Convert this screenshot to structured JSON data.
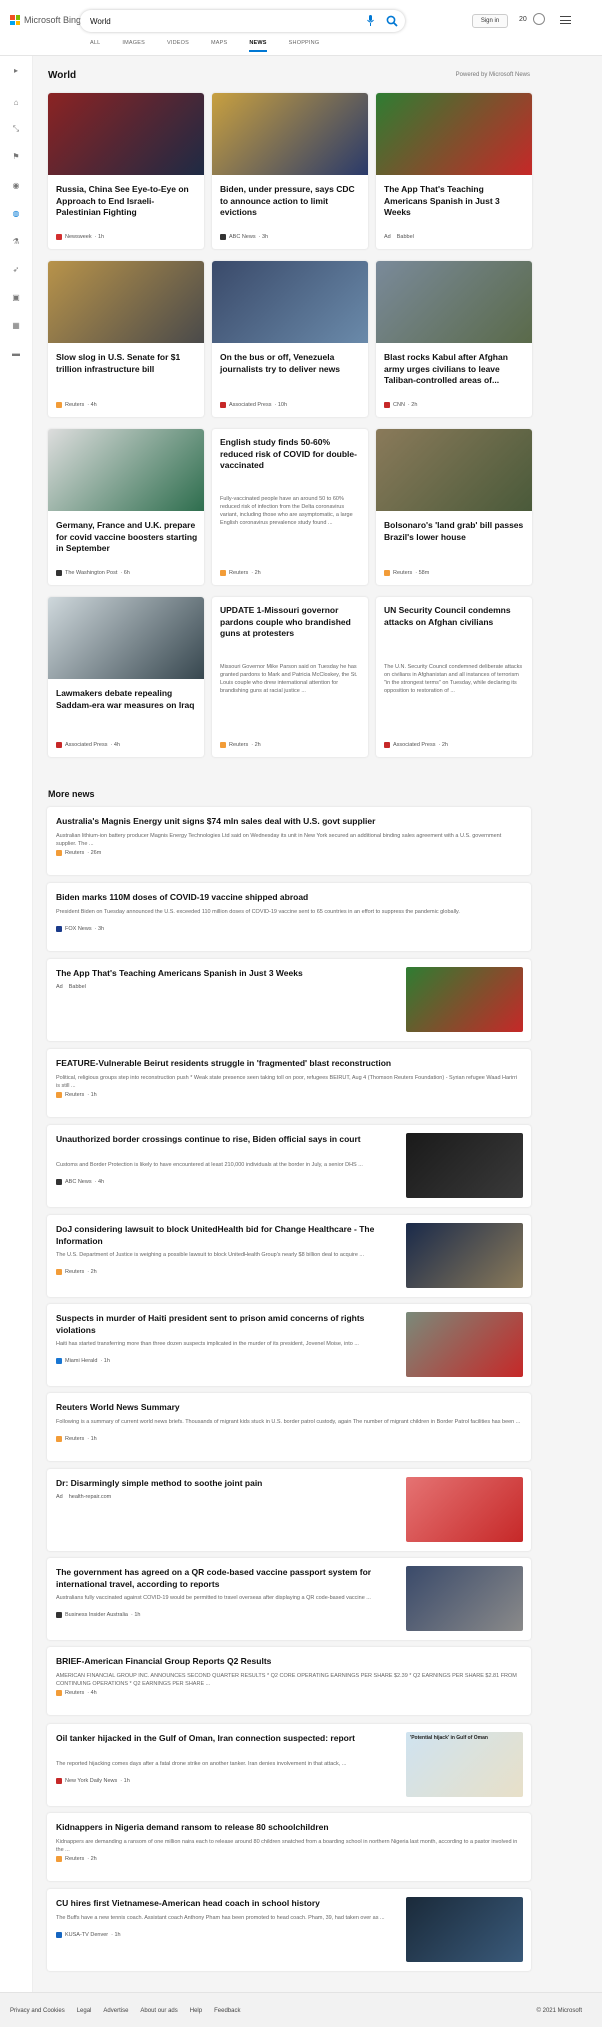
{
  "header": {
    "brand": "Microsoft Bing",
    "search_value": "World",
    "sign_in": "Sign in",
    "points": "20"
  },
  "tabs": [
    "ALL",
    "IMAGES",
    "VIDEOS",
    "MAPS",
    "NEWS",
    "SHOPPING"
  ],
  "sidebar": [
    "expand-icon",
    "home-icon",
    "shrink-icon",
    "flag-icon",
    "location-icon",
    "globe-icon",
    "science-icon",
    "rocket-icon",
    "video-icon",
    "grid-icon",
    "card-icon"
  ],
  "section": {
    "title": "World",
    "powered": "Powered by Microsoft News"
  },
  "cards": [
    {
      "title": "Russia, China See Eye-to-Eye on Approach to End Israeli-Palestinian Fighting",
      "source": "Newsweek",
      "time": "1h",
      "desc": "",
      "c1": "#8b2323",
      "c2": "#1e2a44",
      "ic": "#d32f2f"
    },
    {
      "title": "Biden, under pressure, says CDC to announce action to limit evictions",
      "source": "ABC News",
      "time": "3h",
      "desc": "",
      "c1": "#c8a040",
      "c2": "#2a3a6a",
      "ic": "#333333"
    },
    {
      "title": "The App That's Teaching Americans Spanish in Just 3 Weeks",
      "source": "Babbel",
      "time": "",
      "ad": "Ad",
      "desc": "",
      "c1": "#2e7d32",
      "c2": "#c62828",
      "ic": ""
    },
    {
      "title": "Slow slog in U.S. Senate for $1 trillion infrastructure bill",
      "source": "Reuters",
      "time": "4h",
      "desc": "",
      "c1": "#b8934a",
      "c2": "#4a4a4a",
      "ic": "#f29c38"
    },
    {
      "title": "On the bus or off, Venezuela journalists try to deliver news",
      "source": "Associated Press",
      "time": "10h",
      "desc": "",
      "c1": "#3a4a6a",
      "c2": "#6a8aaa",
      "ic": "#c62828"
    },
    {
      "title": "Blast rocks Kabul after Afghan army urges civilians to leave Taliban-controlled areas of...",
      "source": "CNN",
      "time": "2h",
      "desc": "",
      "c1": "#7a8a9a",
      "c2": "#5a6a4a",
      "ic": "#c62828"
    },
    {
      "title": "Germany, France and U.K. prepare for covid vaccine boosters starting in September",
      "source": "The Washington Post",
      "time": "6h",
      "desc": "",
      "c1": "#dddddd",
      "c2": "#2e6e4e",
      "ic": "#333333"
    },
    {
      "title": "English study finds 50-60% reduced risk of COVID for double-vaccinated",
      "source": "Reuters",
      "time": "2h",
      "desc": "Fully-vaccinated people have an around 50 to 60% reduced risk of infection from the Delta coronavirus variant, including those who are asymptomatic, a large English coronavirus prevalence study found ...",
      "noimg": true,
      "ic": "#f29c38"
    },
    {
      "title": "Bolsonaro's 'land grab' bill passes Brazil's lower house",
      "source": "Reuters",
      "time": "58m",
      "desc": "",
      "c1": "#8a7a5a",
      "c2": "#4a5a3a",
      "ic": "#f29c38"
    },
    {
      "title": "Lawmakers debate repealing Saddam-era war measures on Iraq",
      "source": "Associated Press",
      "time": "4h",
      "desc": "",
      "c1": "#cfd8dc",
      "c2": "#37474f",
      "ic": "#c62828"
    },
    {
      "title": "UPDATE 1-Missouri governor pardons couple who brandished guns at protesters",
      "source": "Reuters",
      "time": "2h",
      "desc": "Missouri Governor Mike Parson said on Tuesday he has granted pardons to Mark and Patricia McCloskey, the St. Louis couple who drew international attention for brandishing guns at racial justice ...",
      "noimg": true,
      "ic": "#f29c38"
    },
    {
      "title": "UN Security Council condemns attacks on Afghan civilians",
      "source": "Associated Press",
      "time": "2h",
      "desc": "The U.N. Security Council condemned deliberate attacks on civilians in Afghanistan and all instances of terrorism \"in the strongest terms\" on Tuesday, while declaring its opposition to restoration of ...",
      "noimg": true,
      "ic": "#c62828"
    }
  ],
  "more": {
    "title": "More news"
  },
  "items": [
    {
      "title": "Australia's Magnis Energy unit signs $74 mln sales deal with U.S. govt supplier",
      "desc": "Australian lithium-ion battery producer Magnis Energy Technologies Ltd said on Wednesday its unit in New York secured an additional binding sales agreement with a U.S. government supplier. The ...",
      "source": "Reuters",
      "time": "26m",
      "ic": "#f29c38"
    },
    {
      "title": "Biden marks 110M doses of COVID-19 vaccine shipped abroad",
      "desc": "President Biden on Tuesday announced the U.S. exceeded 110 million doses of COVID-19 vaccine sent to 65 countries in an effort to suppress the pandemic globally.",
      "source": "FOX News",
      "time": "3h",
      "ic": "#1a3a8a"
    },
    {
      "title": "The App That's Teaching Americans Spanish in Just 3 Weeks",
      "desc": "",
      "source": "Babbel",
      "time": "",
      "ad": "Ad",
      "thumb": [
        "#2e7d32",
        "#c62828"
      ]
    },
    {
      "title": "FEATURE-Vulnerable Beirut residents struggle in 'fragmented' blast reconstruction",
      "desc": "Political, religious groups step into reconstruction push * Weak state presence seen taking toll on poor, refugees BEIRUT, Aug 4 (Thomson Reuters Foundation) - Syrian refugee Waad Harirri is still ...",
      "source": "Reuters",
      "time": "1h",
      "ic": "#f29c38"
    },
    {
      "title": "Unauthorized border crossings continue to rise, Biden official says in court",
      "desc": "Customs and Border Protection is likely to have encountered at least 210,000 individuals at the border in July, a senior DHS ...",
      "source": "ABC News",
      "time": "4h",
      "ic": "#333333",
      "thumb": [
        "#1a1a1a",
        "#3a3a3a"
      ]
    },
    {
      "title": "DoJ considering lawsuit to block UnitedHealth bid for Change Healthcare - The Information",
      "desc": "The U.S. Department of Justice is weighing a possible lawsuit to block UnitedHealth Group's nearly $8 billion deal to acquire ...",
      "source": "Reuters",
      "time": "2h",
      "ic": "#f29c38",
      "thumb": [
        "#1a2a4a",
        "#8a7a5a"
      ]
    },
    {
      "title": "Suspects in murder of Haiti president sent to prison amid concerns of rights violations",
      "desc": "Haiti has started transferring more than three dozen suspects implicated in the murder of its president, Jovenel Moise, into ...",
      "source": "Miami Herald",
      "time": "1h",
      "ic": "#1976d2",
      "thumb": [
        "#7a8a7a",
        "#c62828"
      ]
    },
    {
      "title": "Reuters World News Summary",
      "desc": "Following is a summary of current world news briefs. Thousands of migrant kids stuck in U.S. border patrol custody, again The number of migrant children in Border Patrol facilities has been ...",
      "source": "Reuters",
      "time": "1h",
      "ic": "#f29c38"
    },
    {
      "title": "Dr: Disarmingly simple method to soothe joint pain",
      "desc": "",
      "source": "health-repair.com",
      "time": "",
      "ad": "Ad",
      "thumb": [
        "#e57373",
        "#c62828"
      ]
    },
    {
      "title": "The government has agreed on a QR code-based vaccine passport system for international travel, according to reports",
      "desc": "Australians fully vaccinated against COVID-19 would be permitted to travel overseas after displaying a QR code-based vaccine ...",
      "source": "Business Insider Australia",
      "time": "1h",
      "ic": "#333333",
      "thumb": [
        "#3a4a6a",
        "#8a8a8a"
      ]
    },
    {
      "title": "BRIEF-American Financial Group Reports Q2 Results",
      "desc": "AMERICAN FINANCIAL GROUP INC. ANNOUNCES SECOND QUARTER RESULTS * Q2 CORE OPERATING EARNINGS PER SHARE $2.39 * Q2 EARNINGS PER SHARE $2.81 FROM CONTINUING OPERATIONS * Q2 EARNINGS PER SHARE ...",
      "source": "Reuters",
      "time": "4h",
      "ic": "#f29c38"
    },
    {
      "title": "Oil tanker hijacked in the Gulf of Oman, Iran connection suspected: report",
      "desc": "The reported hijacking comes days after a fatal drone strike on another tanker. Iran denies involvement in that attack, ...",
      "source": "New York Daily News",
      "time": "1h",
      "ic": "#c62828",
      "thumb": [
        "#cfe3f0",
        "#e8e0c8"
      ],
      "thumbtext": "'Potential hijack' in Gulf of Oman"
    },
    {
      "title": "Kidnappers in Nigeria demand ransom to release 80 schoolchildren",
      "desc": "Kidnappers are demanding a ransom of one million naira each to release around 80 children snatched from a boarding school in northern Nigeria last month, according to a pastor involved in the ...",
      "source": "Reuters",
      "time": "2h",
      "ic": "#f29c38"
    },
    {
      "title": "CU hires first Vietnamese-American head coach in school history",
      "desc": "The Buffs have a new tennis coach. Assistant coach Anthony Pham has been promoted to head coach. Pham, 39, had taken over as ...",
      "source": "KUSA-TV Denver",
      "time": "1h",
      "ic": "#1565c0",
      "thumb": [
        "#1a2a3a",
        "#3a5a7a"
      ]
    }
  ],
  "footer": {
    "links": [
      "Privacy and Cookies",
      "Legal",
      "Advertise",
      "About our ads",
      "Help",
      "Feedback"
    ],
    "copyright": "© 2021 Microsoft"
  }
}
